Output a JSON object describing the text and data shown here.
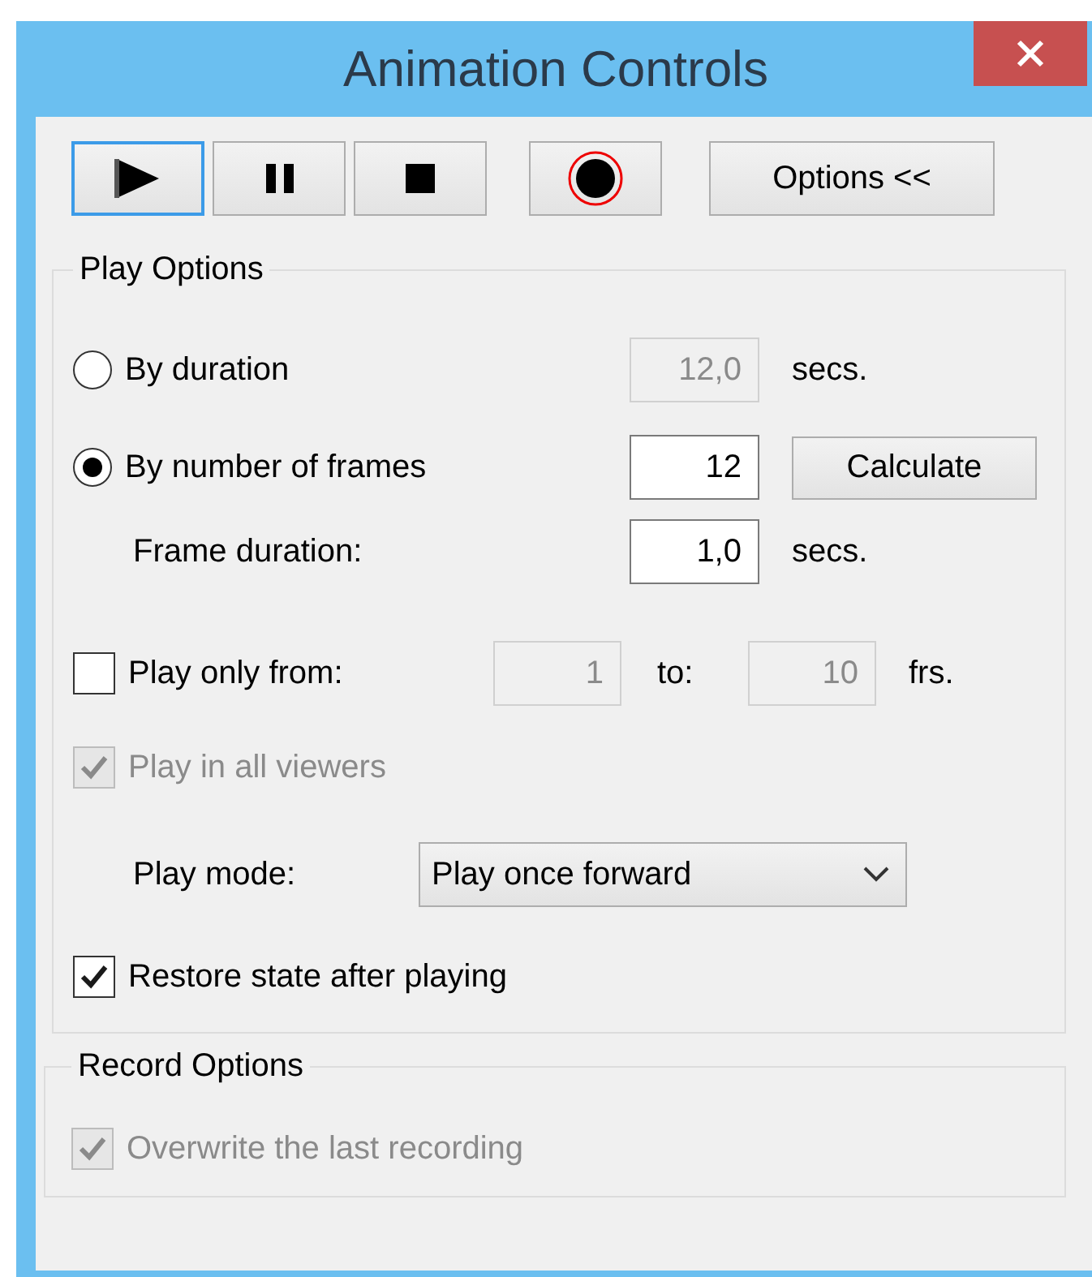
{
  "window": {
    "title": "Animation Controls"
  },
  "toolbar": {
    "buttons": [
      {
        "kind": "play",
        "focused": true
      },
      {
        "kind": "pause",
        "focused": false
      },
      {
        "kind": "stop",
        "focused": false
      },
      {
        "kind": "record",
        "focused": false
      }
    ],
    "options_button": "Options <<"
  },
  "play_options": {
    "title": "Play Options",
    "by_duration": {
      "label": "By duration",
      "selected": false,
      "value": "12,0",
      "disabled": true,
      "unit": "secs."
    },
    "by_frames": {
      "label": "By number of frames",
      "selected": true,
      "value": "12",
      "disabled": false,
      "button": "Calculate"
    },
    "frame_duration": {
      "label": "Frame duration:",
      "value": "1,0",
      "unit": "secs."
    },
    "play_range": {
      "label": "Play only from:",
      "checked": false,
      "from": "1",
      "to_label": "to:",
      "to": "10",
      "unit": "frs.",
      "fields_disabled": true
    },
    "all_viewers": {
      "label": "Play in all viewers",
      "checked": true,
      "disabled": true
    },
    "play_mode": {
      "label": "Play mode:",
      "value": "Play once forward"
    },
    "restore_state": {
      "label": "Restore state after playing",
      "checked": true,
      "disabled": false
    }
  },
  "record_options": {
    "title": "Record Options",
    "overwrite": {
      "label": "Overwrite the last recording",
      "checked": true,
      "disabled": true
    }
  }
}
